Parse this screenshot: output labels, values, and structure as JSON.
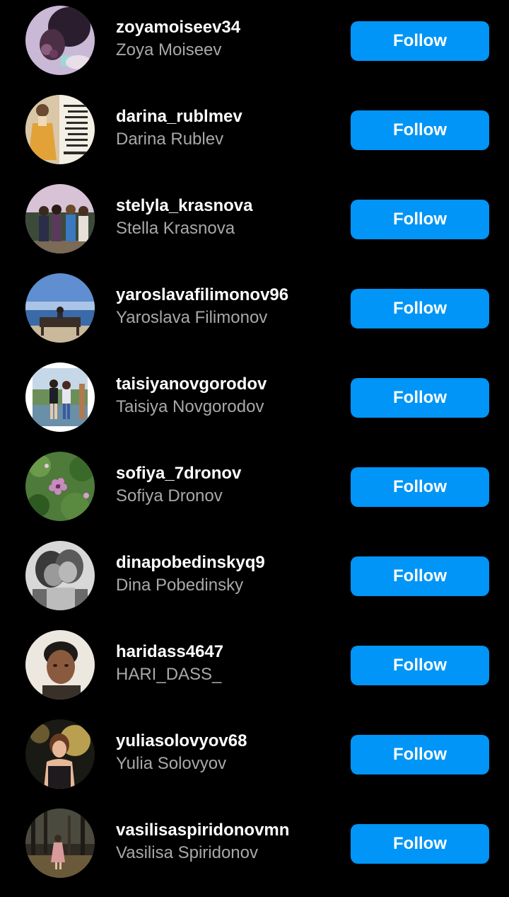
{
  "accent_color": "#0095f6",
  "accounts": [
    {
      "username": "zoyamoiseev34",
      "full_name": "Zoya Moiseev",
      "follow_label": "Follow"
    },
    {
      "username": "darina_rublmev",
      "full_name": "Darina Rublev",
      "follow_label": "Follow"
    },
    {
      "username": "stelyla_krasnova",
      "full_name": "Stella Krasnova",
      "follow_label": "Follow"
    },
    {
      "username": "yaroslavafilimonov96",
      "full_name": "Yaroslava Filimonov",
      "follow_label": "Follow"
    },
    {
      "username": "taisiyanovgorodov",
      "full_name": "Taisiya Novgorodov",
      "follow_label": "Follow"
    },
    {
      "username": "sofiya_7dronov",
      "full_name": "Sofiya Dronov",
      "follow_label": "Follow"
    },
    {
      "username": "dinapobedinskyq9",
      "full_name": "Dina Pobedinsky",
      "follow_label": "Follow"
    },
    {
      "username": "haridass4647",
      "full_name": "HARI_DASS_",
      "follow_label": "Follow"
    },
    {
      "username": "yuliasolovyov68",
      "full_name": "Yulia Solovyov",
      "follow_label": "Follow"
    },
    {
      "username": "vasilisaspiridonovmn",
      "full_name": "Vasilisa Spiridonov",
      "follow_label": "Follow"
    }
  ]
}
